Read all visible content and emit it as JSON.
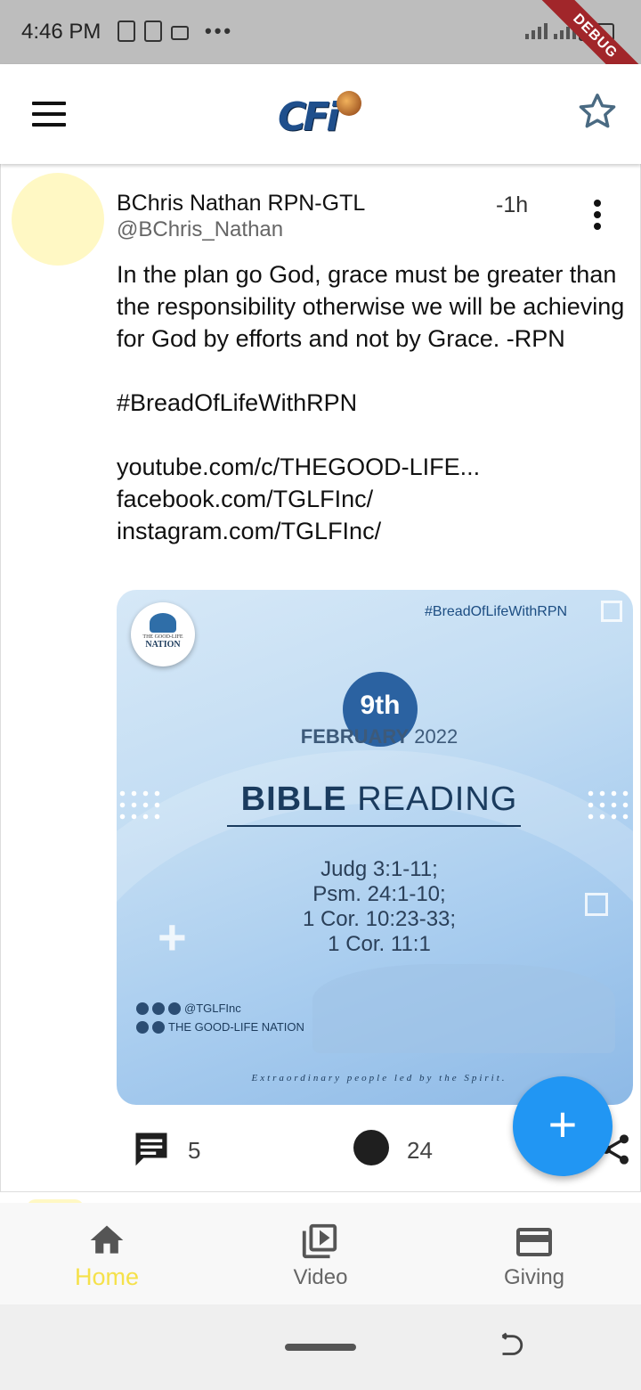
{
  "status_bar": {
    "time": "4:46 PM",
    "debug_label": "DEBUG"
  },
  "app_bar": {
    "logo_text": "CFi",
    "icons": [
      "menu-icon",
      "star-icon"
    ]
  },
  "post": {
    "author_name": "BChris Nathan RPN-GTL",
    "author_handle": "@BChris_Nathan",
    "time": "-1h",
    "text": "In the plan go God, grace must be greater than the responsibility otherwise we will be achieving for God by efforts and not by Grace. -RPN\n\n#BreadOfLifeWithRPN\n\nyoutube.com/c/THEGOOD-LIFE...\nfacebook.com/TGLFInc/\ninstagram.com/TGLFInc/",
    "image": {
      "logo_top": "THE GOOD-LIFE",
      "logo_bottom": "NATION",
      "hashtag": "#BreadOfLifeWithRPN",
      "day": "9th",
      "month": "FEBRUARY",
      "year": "2022",
      "title_bold": "BIBLE",
      "title_light": "READING",
      "readings": "Judg 3:1-11;\nPsm. 24:1-10;\n1 Cor. 10:23-33;\n1 Cor. 11:1",
      "social_handle": "@TGLFInc",
      "social_name": "THE GOOD-LIFE NATION",
      "tagline": "Extraordinary people led by the Spirit."
    },
    "comment_count": "5",
    "like_count": "24"
  },
  "fab": {
    "label": "+"
  },
  "bottom_nav": {
    "items": [
      {
        "label": "Home",
        "icon": "home-icon",
        "active": true
      },
      {
        "label": "Video",
        "icon": "video-library-icon",
        "active": false
      },
      {
        "label": "Giving",
        "icon": "credit-card-icon",
        "active": false
      }
    ],
    "active_color": "#f5e14a"
  },
  "colors": {
    "fab": "#2196f3",
    "avatar": "#fff8c4"
  }
}
